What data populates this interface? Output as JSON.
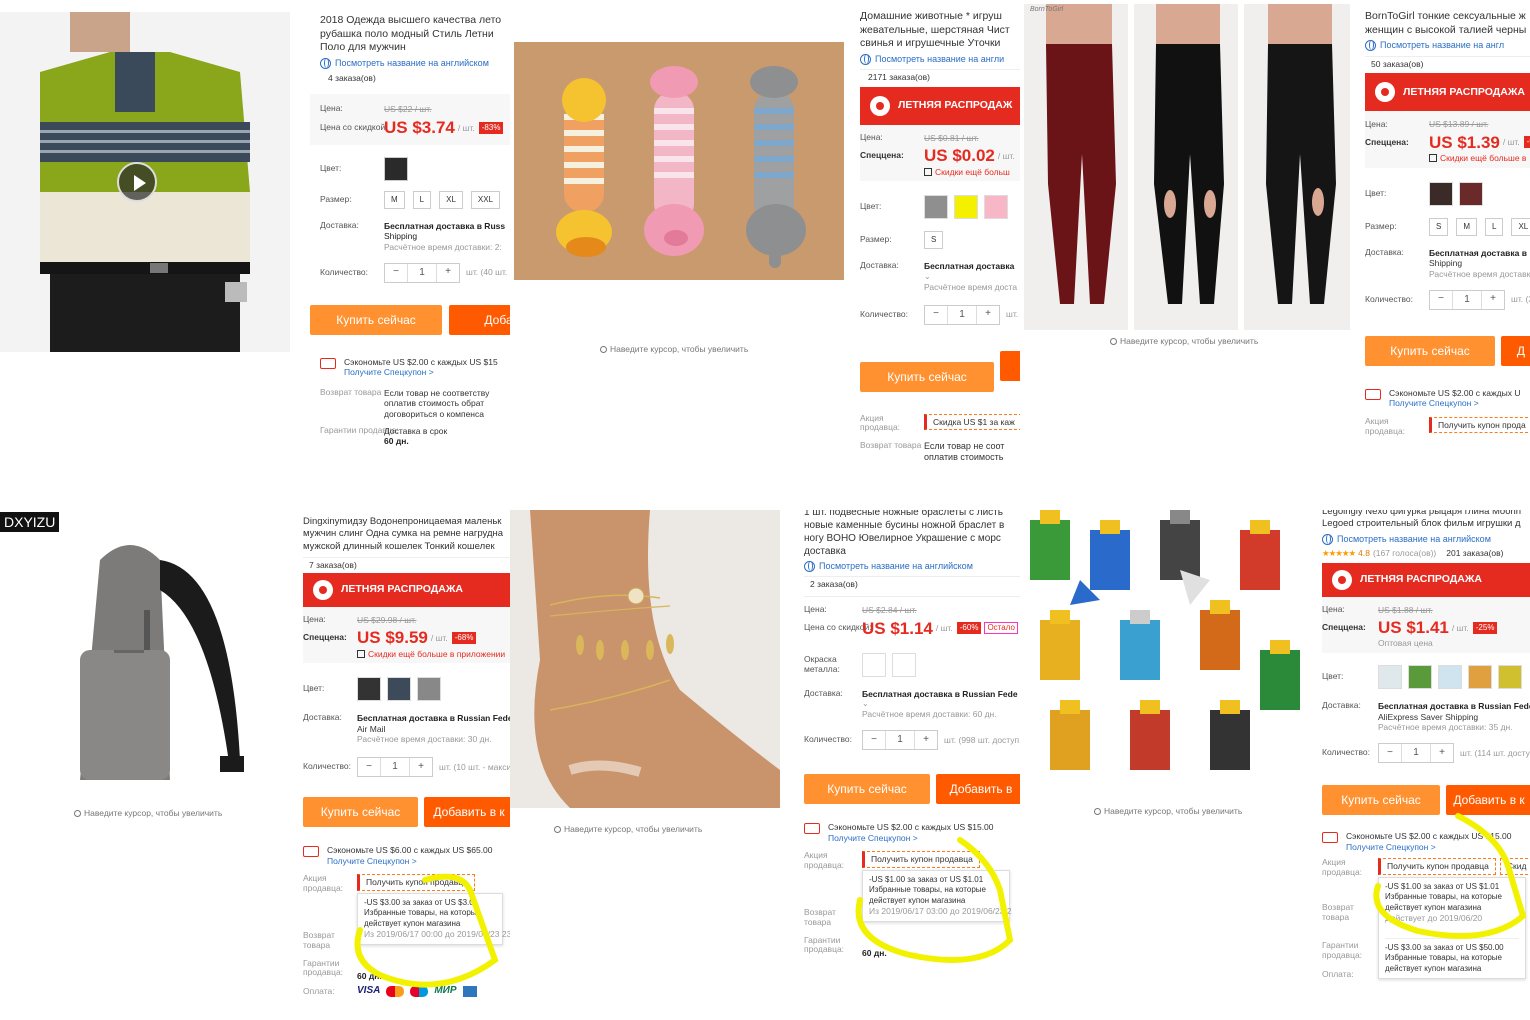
{
  "cells": {
    "polo": {
      "title": "2018 Одежда высшего качества лето рубашка поло модный Стиль Летни Поло для мужчин",
      "english_link": "Посмотреть название на английском",
      "orders": "4 заказа(ов)",
      "price_label": "Цена:",
      "old_price": "US $22 / шт.",
      "discount_label": "Цена со скидкой:",
      "price": "US $3.74",
      "unit": "/ шт.",
      "discount": "-83%",
      "color_label": "Цвет:",
      "size_label": "Размер:",
      "sizes": [
        "M",
        "L",
        "XL",
        "XXL"
      ],
      "delivery_label": "Доставка:",
      "delivery": "Бесплатная доставка в Russ",
      "delivery_method": "Shipping",
      "delivery_time": "Расчётное время доставки: 2:",
      "qty_label": "Количество:",
      "qty": "1",
      "stock": "шт. (40 шт.",
      "buy": "Купить сейчас",
      "add": "Доба",
      "save": "Сэкономьте US $2.00 с каждых US $15",
      "coupon_link": "Получите Спецкупон >",
      "return_label": "Возврат товара",
      "return_text": "Если товар не соответству оплатив стоимость обрат договориться о компенса",
      "guarantee_label": "Гарантии продавца:",
      "guarantee_text": "Доставка в срок",
      "days": "60 дн."
    },
    "toys": {
      "title": "Домашние животные * игруш жевательные, шерстяная Чист свинья и игрушечные Уточки",
      "english_link": "Посмотреть название на англи",
      "orders": "2171 заказа(ов)",
      "sale": "ЛЕТНЯЯ РАСПРОДАЖ",
      "price_label": "Цена:",
      "old_price": "US $0.81 / шт.",
      "special_label": "Спеццена:",
      "price": "US $0.02",
      "unit": "/ шт.",
      "app_note": "Скидки ещё больш",
      "color_label": "Цвет:",
      "colors": [
        "#8f8f8f",
        "#f5f000",
        "#f7b7c6"
      ],
      "size_label": "Размер:",
      "size": "S",
      "delivery_label": "Доставка:",
      "delivery": "Бесплатная доставка",
      "delivery_time": "Расчётное время доста",
      "qty_label": "Количество:",
      "qty": "1",
      "stock": "шт.",
      "buy": "Купить сейчас",
      "promo_label": "Акция продавца:",
      "promo": "Скидка US $1 за каж",
      "return_label": "Возврат товара",
      "return_text": "Если товар не соот оплатив стоимость",
      "zoom": "Наведите курсор, чтобы увеличить"
    },
    "leggings": {
      "brand_watermark": "BornToGirl",
      "title": "BornToGirl тонкие сексуальные ж женщин с высокой талией черны",
      "english_link": "Посмотреть название на англ",
      "orders": "50 заказа(ов)",
      "sale": "ЛЕТНЯЯ РАСПРОДАЖА",
      "price_label": "Цена:",
      "old_price": "US $13.89 / шт.",
      "special_label": "Спеццена:",
      "price": "US $1.39",
      "unit": "/ шт.",
      "discount": "-9",
      "app_note": "Скидки ещё больше в",
      "color_label": "Цвет:",
      "size_label": "Размер:",
      "sizes": [
        "S",
        "M",
        "L",
        "XL"
      ],
      "delivery_label": "Доставка:",
      "delivery": "Бесплатная доставка в",
      "delivery_method": "Shipping",
      "delivery_time": "Расчётное время доставк",
      "qty_label": "Количество:",
      "qty": "1",
      "stock": "шт. (3",
      "buy": "Купить сейчас",
      "add": "Д",
      "save": "Сэкономьте US $2.00 с каждых U",
      "coupon_link": "Получите Спецкупон >",
      "promo_label": "Акция продавца:",
      "promo": "Получить купон прода",
      "zoom": "Наведите курсор, чтобы увеличить"
    },
    "bag": {
      "brand": "DXYIZU",
      "title": "Dingxinymидзу Водонепроницаемая маленьк мужчин слинг Одна сумка на ремне нагрудна мужской длинный кошелек Тонкий кошелек",
      "orders": "7 заказа(ов)",
      "sale": "ЛЕТНЯЯ РАСПРОДАЖА",
      "price_label": "Цена:",
      "old_price": "US $29.98 / шт.",
      "special_label": "Спеццена:",
      "price": "US $9.59",
      "unit": "/ шт.",
      "discount": "-68%",
      "app_note": "Скидки ещё больше в приложении",
      "color_label": "Цвет:",
      "delivery_label": "Доставка:",
      "delivery": "Бесплатная доставка в Russian Federat",
      "delivery_method": "Air Mail",
      "delivery_time": "Расчётное время доставки: 30 дн.",
      "qty_label": "Количество:",
      "qty": "1",
      "stock": "шт. (10 шт. - максиму",
      "buy": "Купить сейчас",
      "add": "Добавить в к",
      "save": "Сэкономьте US $6.00 с каждых US $65.00",
      "coupon_link": "Получите Спецкупон >",
      "promo_label": "Акция продавца:",
      "promo": "Получить купон продавца",
      "popup_line1": "-US $3.00 за заказ от US $3.01",
      "popup_line2": "Избранные товары, на которые действует купон магазина",
      "popup_line3": "Из 2019/06/17 00:00 до 2019/06/23 23:5",
      "return_label": "Возврат товара",
      "guarantee_label": "Гарантии продавца:",
      "days": "60 дн.",
      "pay_label": "Оплата:",
      "pay": [
        "VISA",
        "MC",
        "MC",
        "МИР",
        "AMEX"
      ],
      "zoom": "Наведите курсор, чтобы увеличить"
    },
    "anklet": {
      "title": "1 шт. подвесные ножные браслеты с листь новые каменные бусины ножной браслет в ногу BOHO Ювелирное Украшение с морс доставка",
      "english_link": "Посмотреть название на английском",
      "orders": "2 заказа(ов)",
      "price_label": "Цена:",
      "old_price": "US $2.84 / шт.",
      "discount_label": "Цена со скидкой:",
      "price": "US $1.14",
      "unit": "/ шт.",
      "discount": "-60%",
      "remaining": "Остало",
      "metal_label": "Окраска металла:",
      "delivery_label": "Доставка:",
      "delivery": "Бесплатная доставка в Russian Fede",
      "delivery_time": "Расчётное время доставки: 60 дн.",
      "qty_label": "Количество:",
      "qty": "1",
      "stock": "шт. (998 шт. доступ",
      "buy": "Купить сейчас",
      "add": "Добавить в",
      "save": "Сэкономьте US $2.00 с каждых US $15.00",
      "coupon_link": "Получите Спецкупон >",
      "promo_label": "Акция продавца:",
      "promo": "Получить купон продавца",
      "popup_line1": "-US $1.00 за заказ от US $1.01",
      "popup_line2": "Избранные товары, на которые действует купон магазина",
      "popup_line3": "Из 2019/06/17 03:00 до 2019/06/23 2",
      "return_label": "Возврат товара",
      "guarantee_label": "Гарантии продавца:",
      "days": "60 дн.",
      "zoom": "Наведите курсор, чтобы увеличить"
    },
    "lego": {
      "title": "Legoingly Nexo фигурка рыцаря глина Moorin Legoed строительный блок фильм игрушки д",
      "english_link": "Посмотреть название на английском",
      "rating": "4.8",
      "votes": "(167 голоса(ов))",
      "orders": "201 заказа(ов)",
      "sale": "ЛЕТНЯЯ РАСПРОДАЖА",
      "price_label": "Цена:",
      "old_price": "US $1.88 / шт.",
      "special_label": "Спеццена:",
      "price": "US $1.41",
      "unit": "/ шт.",
      "discount": "-25%",
      "wholesale": "Оптовая цена",
      "color_label": "Цвет:",
      "delivery_label": "Доставка:",
      "delivery": "Бесплатная доставка в Russian Federa",
      "delivery_method": "AliExpress Saver Shipping",
      "delivery_time": "Расчётное время доставки: 35 дн.",
      "qty_label": "Количество:",
      "qty": "1",
      "stock": "шт. (114 шт. доступн",
      "buy": "Купить сейчас",
      "add": "Добавить в к",
      "save": "Сэкономьте US $2.00 с каждых US $15.00",
      "coupon_link": "Получите Спецкупон >",
      "promo_label": "Акция продавца:",
      "promo": "Получить купон продавца",
      "promo_extra": "Скид",
      "popup_line1": "-US $1.00 за заказ от US $1.01",
      "popup_line2": "Избранные товары, на которые действует купон магазина",
      "popup_line3": "Действует до 2019/06/20",
      "popup2_line1": "-US $3.00 за заказ от US $50.00",
      "popup2_line2": "Избранные товары, на которые действует купон магазина",
      "return_label": "Возврат товара",
      "guarantee_label": "Гарантии продавца:",
      "pay_label": "Оплата:",
      "zoom": "Наведите курсор, чтобы увеличить"
    }
  },
  "colors": {
    "accent_red": "#e52b20",
    "buy_orange": "#ff9130",
    "add_orange": "#ff5a00",
    "link_blue": "#2a6ec6",
    "highlight_yellow": "#f2f200"
  }
}
